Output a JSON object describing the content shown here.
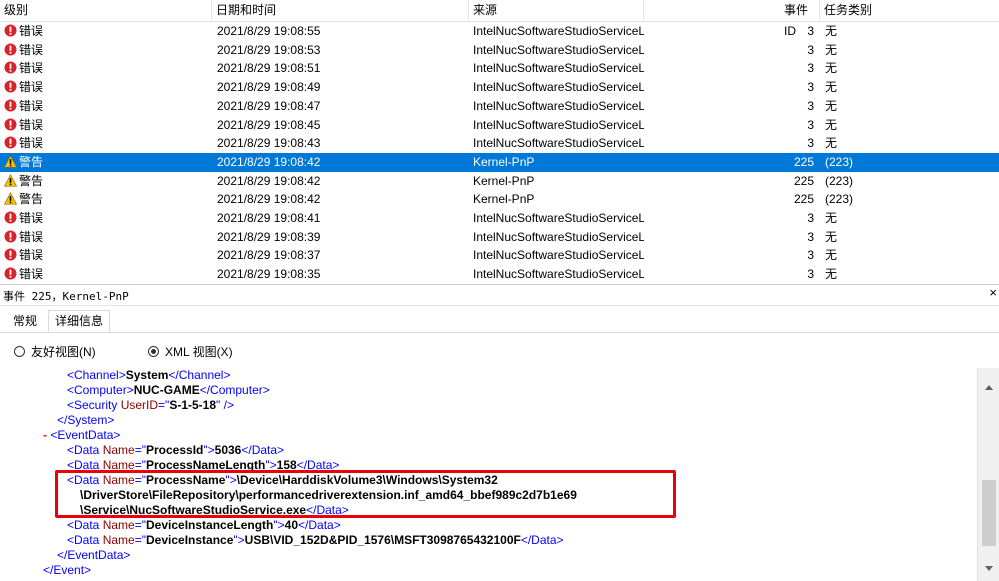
{
  "grid": {
    "columns": {
      "level": "级别",
      "date": "日期和时间",
      "source": "来源",
      "event_id": "事件 ID",
      "task": "任务类别"
    },
    "rows": [
      {
        "level": "错误",
        "type": "error",
        "date": "2021/8/29 19:08:55",
        "source": "IntelNucSoftwareStudioServiceL...",
        "id": "3",
        "task": "无",
        "selected": false
      },
      {
        "level": "错误",
        "type": "error",
        "date": "2021/8/29 19:08:53",
        "source": "IntelNucSoftwareStudioServiceL...",
        "id": "3",
        "task": "无",
        "selected": false
      },
      {
        "level": "错误",
        "type": "error",
        "date": "2021/8/29 19:08:51",
        "source": "IntelNucSoftwareStudioServiceL...",
        "id": "3",
        "task": "无",
        "selected": false
      },
      {
        "level": "错误",
        "type": "error",
        "date": "2021/8/29 19:08:49",
        "source": "IntelNucSoftwareStudioServiceL...",
        "id": "3",
        "task": "无",
        "selected": false
      },
      {
        "level": "错误",
        "type": "error",
        "date": "2021/8/29 19:08:47",
        "source": "IntelNucSoftwareStudioServiceL...",
        "id": "3",
        "task": "无",
        "selected": false
      },
      {
        "level": "错误",
        "type": "error",
        "date": "2021/8/29 19:08:45",
        "source": "IntelNucSoftwareStudioServiceL...",
        "id": "3",
        "task": "无",
        "selected": false
      },
      {
        "level": "错误",
        "type": "error",
        "date": "2021/8/29 19:08:43",
        "source": "IntelNucSoftwareStudioServiceL...",
        "id": "3",
        "task": "无",
        "selected": false
      },
      {
        "level": "警告",
        "type": "warning",
        "date": "2021/8/29 19:08:42",
        "source": "Kernel-PnP",
        "id": "225",
        "task": "(223)",
        "selected": true
      },
      {
        "level": "警告",
        "type": "warning",
        "date": "2021/8/29 19:08:42",
        "source": "Kernel-PnP",
        "id": "225",
        "task": "(223)",
        "selected": false
      },
      {
        "level": "警告",
        "type": "warning",
        "date": "2021/8/29 19:08:42",
        "source": "Kernel-PnP",
        "id": "225",
        "task": "(223)",
        "selected": false
      },
      {
        "level": "错误",
        "type": "error",
        "date": "2021/8/29 19:08:41",
        "source": "IntelNucSoftwareStudioServiceL...",
        "id": "3",
        "task": "无",
        "selected": false
      },
      {
        "level": "错误",
        "type": "error",
        "date": "2021/8/29 19:08:39",
        "source": "IntelNucSoftwareStudioServiceL...",
        "id": "3",
        "task": "无",
        "selected": false
      },
      {
        "level": "错误",
        "type": "error",
        "date": "2021/8/29 19:08:37",
        "source": "IntelNucSoftwareStudioServiceL...",
        "id": "3",
        "task": "无",
        "selected": false
      },
      {
        "level": "错误",
        "type": "error",
        "date": "2021/8/29 19:08:35",
        "source": "IntelNucSoftwareStudioServiceL...",
        "id": "3",
        "task": "无",
        "selected": false
      }
    ]
  },
  "detail": {
    "title": "事件 225，Kernel-PnP",
    "close_glyph": "×",
    "tabs": [
      "常规",
      "详细信息"
    ],
    "active_tab": 1,
    "view_modes": [
      {
        "label": "友好视图(N)",
        "selected": false
      },
      {
        "label": "XML 视图(X)",
        "selected": true
      }
    ]
  },
  "xml": {
    "channel": "System",
    "computer": "NUC-GAME",
    "security_user_id": "S-1-5-18",
    "collapse_glyph": "-",
    "process_id": "5036",
    "process_name_length": "158",
    "process_name_line1": "\\Device\\HarddiskVolume3\\Windows\\System32",
    "process_name_line2": "\\DriverStore\\FileRepository\\performancedriverextension.inf_amd64_bbef989c2d7b1e69",
    "process_name_line3": "\\Service\\NucSoftwareStudioService.exe",
    "device_instance_length": "40",
    "device_instance": "USB\\VID_152D&PID_1576\\MSFT3098765432100F"
  },
  "colors": {
    "selection": "#0078d7",
    "xml_tag": "#0000ff",
    "xml_attr_name": "#8b0000",
    "highlight_box": "#e8000b"
  }
}
